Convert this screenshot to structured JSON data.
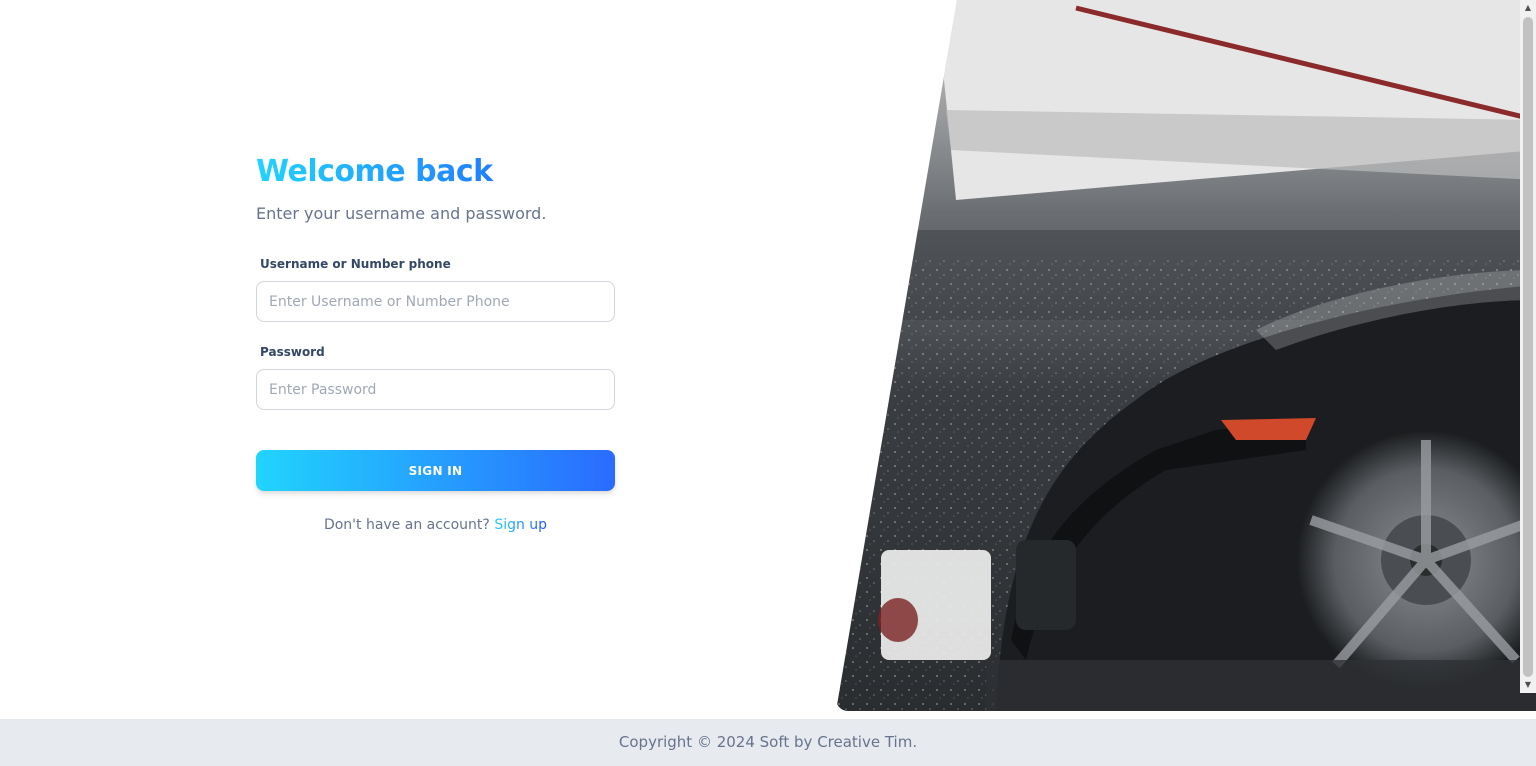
{
  "form": {
    "title": "Welcome back",
    "subtitle": "Enter your username and password.",
    "username_label": "Username or Number phone",
    "username_placeholder": "Enter Username or Number Phone",
    "password_label": "Password",
    "password_placeholder": "Enter Password",
    "submit_label": "SIGN IN",
    "signup_prompt": "Don't have an account?",
    "signup_link": "Sign up"
  },
  "footer": {
    "copyright": "Copyright © 2024 Soft by Creative Tim."
  },
  "colors": {
    "gradient_start": "#21d4fd",
    "gradient_end": "#2152ff",
    "text_muted": "#67748e",
    "label_text": "#344767",
    "footer_bg": "#e7eaee"
  },
  "icons": {
    "scroll_up": "▲",
    "scroll_down": "▼"
  }
}
